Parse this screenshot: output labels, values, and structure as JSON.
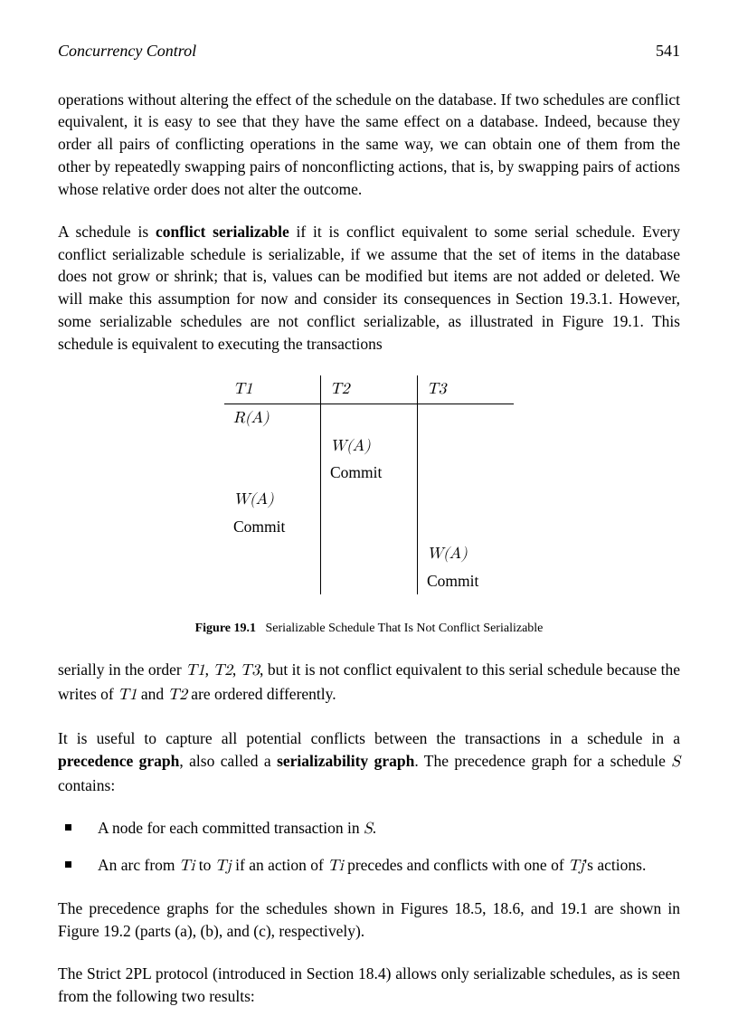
{
  "header": {
    "title": "Concurrency Control",
    "page_number": "541"
  },
  "para1": "operations without altering the effect of the schedule on the database. If two schedules are conflict equivalent, it is easy to see that they have the same effect on a database. Indeed, because they order all pairs of conflicting operations in the same way, we can obtain one of them from the other by repeatedly swapping pairs of nonconflicting actions, that is, by swapping pairs of actions whose relative order does not alter the outcome.",
  "para2_a": "A schedule is ",
  "para2_bold": "conflict serializable",
  "para2_b": " if it is conflict equivalent to some serial schedule. Every conflict serializable schedule is serializable, if we assume that the set of items in the database does not grow or shrink; that is, values can be modified but items are not added or deleted. We will make this assumption for now and consider its consequences in Section 19.3.1. However, some serializable schedules are not conflict serializable, as illustrated in Figure 19.1. This schedule is equivalent to executing the transactions",
  "table": {
    "headers": {
      "c1": "T1",
      "c2": "T2",
      "c3": "T3"
    },
    "rows": [
      {
        "c1": "R(A)",
        "c2": "",
        "c3": ""
      },
      {
        "c1": "",
        "c2": "W(A)",
        "c3": ""
      },
      {
        "c1": "",
        "c2": "Commit",
        "c3": ""
      },
      {
        "c1": "W(A)",
        "c2": "",
        "c3": ""
      },
      {
        "c1": "Commit",
        "c2": "",
        "c3": ""
      },
      {
        "c1": "",
        "c2": "",
        "c3": "W(A)"
      },
      {
        "c1": "",
        "c2": "",
        "c3": "Commit"
      }
    ]
  },
  "caption": {
    "label": "Figure 19.1",
    "text": "Serializable Schedule That Is Not Conflict Serializable"
  },
  "para3_a": "serially in the order ",
  "para3_t1": "T1",
  "para3_b": ", ",
  "para3_t2": "T2",
  "para3_c": ", ",
  "para3_t3": "T3",
  "para3_d": ", but it is not conflict equivalent to this serial schedule because the writes of ",
  "para3_t1b": "T1",
  "para3_e": " and ",
  "para3_t2b": "T2",
  "para3_f": " are ordered differently.",
  "para4_a": "It is useful to capture all potential conflicts between the transactions in a schedule in a ",
  "para4_b1": "precedence graph",
  "para4_b": ", also called a ",
  "para4_b2": "serializability graph",
  "para4_c": ". The precedence graph for a schedule ",
  "para4_s": "S",
  "para4_d": " contains:",
  "bullet1_a": "A node for each committed transaction in ",
  "bullet1_s": "S",
  "bullet1_b": ".",
  "bullet2_a": "An arc from ",
  "bullet2_ti": "Ti",
  "bullet2_b": " to ",
  "bullet2_tj": "Tj",
  "bullet2_c": " if an action of ",
  "bullet2_ti2": "Ti",
  "bullet2_d": " precedes and conflicts with one of ",
  "bullet2_tj2": "Tj",
  "bullet2_e": "'s actions.",
  "para5": "The precedence graphs for the schedules shown in Figures 18.5, 18.6, and 19.1 are shown in Figure 19.2 (parts (a), (b), and (c), respectively).",
  "para6": "The Strict 2PL protocol (introduced in Section 18.4) allows only serializable schedules, as is seen from the following two results:"
}
